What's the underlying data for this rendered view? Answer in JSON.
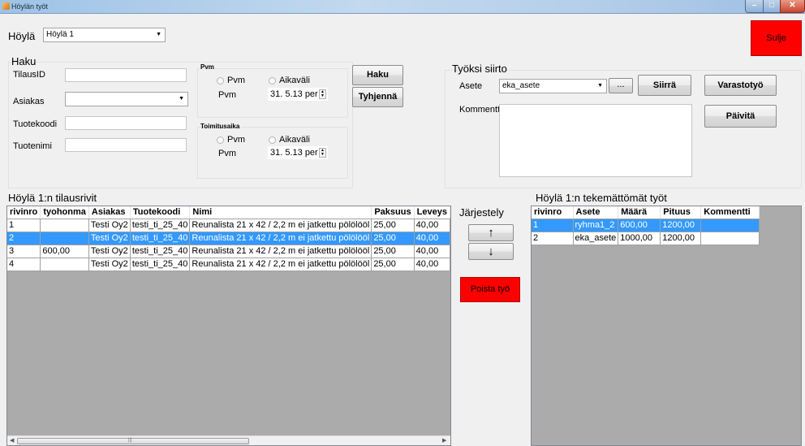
{
  "window": {
    "title": "Höylän työt"
  },
  "top": {
    "hoyla_label": "Höylä",
    "hoyla_value": "Höylä 1",
    "sulje_label": "Sulje"
  },
  "haku": {
    "title": "Haku",
    "tilausid_label": "TilausID",
    "asiakas_label": "Asiakas",
    "tuotekoodi_label": "Tuotekoodi",
    "tuotenimi_label": "Tuotenimi",
    "pvm_group": {
      "title": "Pvm",
      "radio1": "Pvm",
      "radio2": "Aikaväli",
      "date_label": "Pvm",
      "date_value": "31. 5.13  per"
    },
    "toimitus_group": {
      "title": "Toimitusaika",
      "radio1": "Pvm",
      "radio2": "Aikaväli",
      "date_label": "Pvm",
      "date_value": "31. 5.13  per"
    },
    "haku_button": "Haku",
    "tyhjenna_button": "Tyhjennä"
  },
  "siirto": {
    "title": "Työksi siirto",
    "asete_label": "Asete",
    "asete_value": "eka_asete",
    "browse_button": "...",
    "siirra_button": "Siirrä",
    "kommentti_label": "Kommentti",
    "varastotyo_button": "Varastotyö",
    "paivita_button": "Päivitä"
  },
  "left_grid": {
    "title": "Höylä 1:n tilausrivit",
    "columns": [
      "rivinro",
      "tyohonma",
      "Asiakas",
      "Tuotekoodi",
      "Nimi",
      "Paksuus",
      "Leveys"
    ],
    "rows": [
      [
        "1",
        "",
        "Testi Oy2",
        "testi_ti_25_40",
        "Reunalista 21 x 42 / 2,2 m ei jatkettu pölölööl",
        "25,00",
        "40,00"
      ],
      [
        "2",
        "",
        "Testi Oy2",
        "testi_ti_25_40",
        "Reunalista 21 x 42 / 2,2 m ei jatkettu pölölööl",
        "25,00",
        "40,00"
      ],
      [
        "3",
        "600,00",
        "Testi Oy2",
        "testi_ti_25_40",
        "Reunalista 21 x 42 / 2,2 m ei jatkettu pölölööl",
        "25,00",
        "40,00"
      ],
      [
        "4",
        "",
        "Testi Oy2",
        "testi_ti_25_40",
        "Reunalista 21 x 42 / 2,2 m ei jatkettu pölölööl",
        "25,00",
        "40,00"
      ]
    ],
    "selected_row": 1
  },
  "jarjestely": {
    "title": "Järjestely",
    "up_label": "↑",
    "down_label": "↓",
    "poista_button": "Poista työ"
  },
  "right_grid": {
    "title": "Höylä 1:n tekemättömät työt",
    "columns": [
      "rivinro",
      "Asete",
      "Määrä",
      "Pituus",
      "Kommentti"
    ],
    "rows": [
      [
        "1",
        "ryhma1_2",
        "600,00",
        "1200,00",
        ""
      ],
      [
        "2",
        "eka_asete",
        "1000,00",
        "1200,00",
        ""
      ]
    ],
    "selected_row": 0
  },
  "colors": {
    "red": "#ff0000",
    "selection": "#3399ff"
  }
}
